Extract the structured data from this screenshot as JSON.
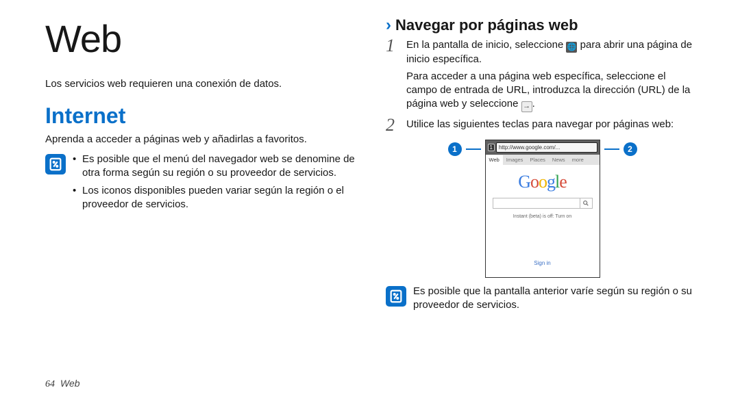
{
  "left": {
    "title": "Web",
    "intro": "Los servicios web requieren una conexión de datos.",
    "h2": "Internet",
    "sub": "Aprenda a acceder a páginas web y añadirlas a favoritos.",
    "notes": [
      "Es posible que el menú del navegador web se denomine de otra forma según su región o su proveedor de servicios.",
      "Los iconos disponibles pueden variar según la región o el proveedor de servicios."
    ]
  },
  "right": {
    "h3": "Navegar por páginas web",
    "step1a": "En la pantalla de inicio, seleccione ",
    "step1b": " para abrir una página de inicio específica.",
    "step1c": "Para acceder a una página web específica, seleccione el campo de entrada de URL, introduzca la dirección (URL) de la página web y seleccione ",
    "step1d": ".",
    "step2": "Utilice las siguientes teclas para navegar por páginas web:",
    "callouts": {
      "a": "1",
      "b": "2"
    },
    "phone": {
      "url": "http://www.google.com/...",
      "tabs": [
        "Web",
        "Images",
        "Places",
        "News",
        "more"
      ],
      "hint": "Instant (beta) is off: Turn on",
      "signin": "Sign in"
    },
    "note2": "Es posible que la pantalla anterior varíe según su región o su proveedor de servicios."
  },
  "footer": {
    "page": "64",
    "title": "Web"
  }
}
